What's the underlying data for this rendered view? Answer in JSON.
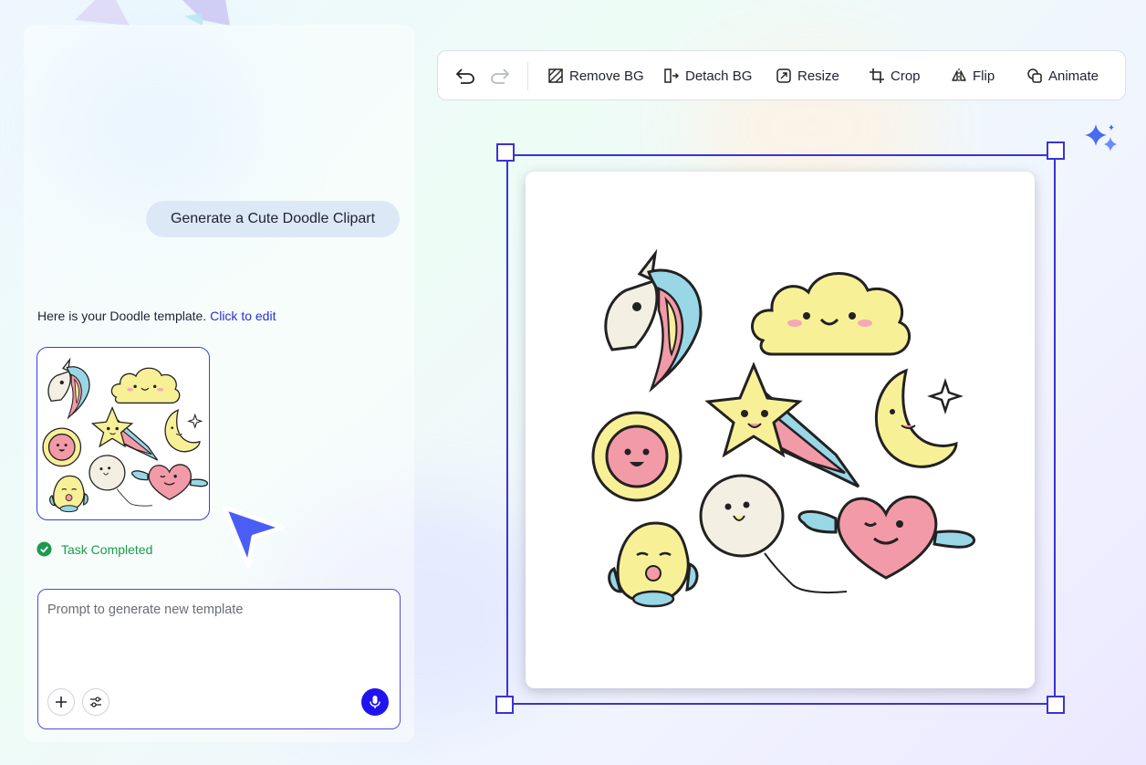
{
  "chat": {
    "user_message": "Generate a Cute Doodle Clipart",
    "reply_text": "Here is your Doodle template.",
    "reply_link": "Click to edit",
    "status_text": "Task Completed"
  },
  "prompt": {
    "placeholder": "Prompt to generate new template"
  },
  "toolbar": {
    "remove_bg": "Remove BG",
    "detach_bg": "Detach BG",
    "resize": "Resize",
    "crop": "Crop",
    "flip": "Flip",
    "animate": "Animate"
  },
  "icons": {
    "undo": "undo-icon",
    "redo": "redo-icon",
    "remove_bg": "remove-bg-icon",
    "detach_bg": "detach-bg-icon",
    "resize": "resize-icon",
    "crop": "crop-icon",
    "flip": "flip-icon",
    "animate": "animate-icon",
    "add": "plus-icon",
    "settings": "sliders-icon",
    "mic": "microphone-icon",
    "status": "check-circle-icon",
    "magic": "sparkle-icon"
  },
  "colors": {
    "accent": "#3a33d4",
    "mic_button": "#1f14f0",
    "link": "#2a2fd6",
    "success": "#1d9a4d",
    "user_bubble": "#dde8f7"
  }
}
